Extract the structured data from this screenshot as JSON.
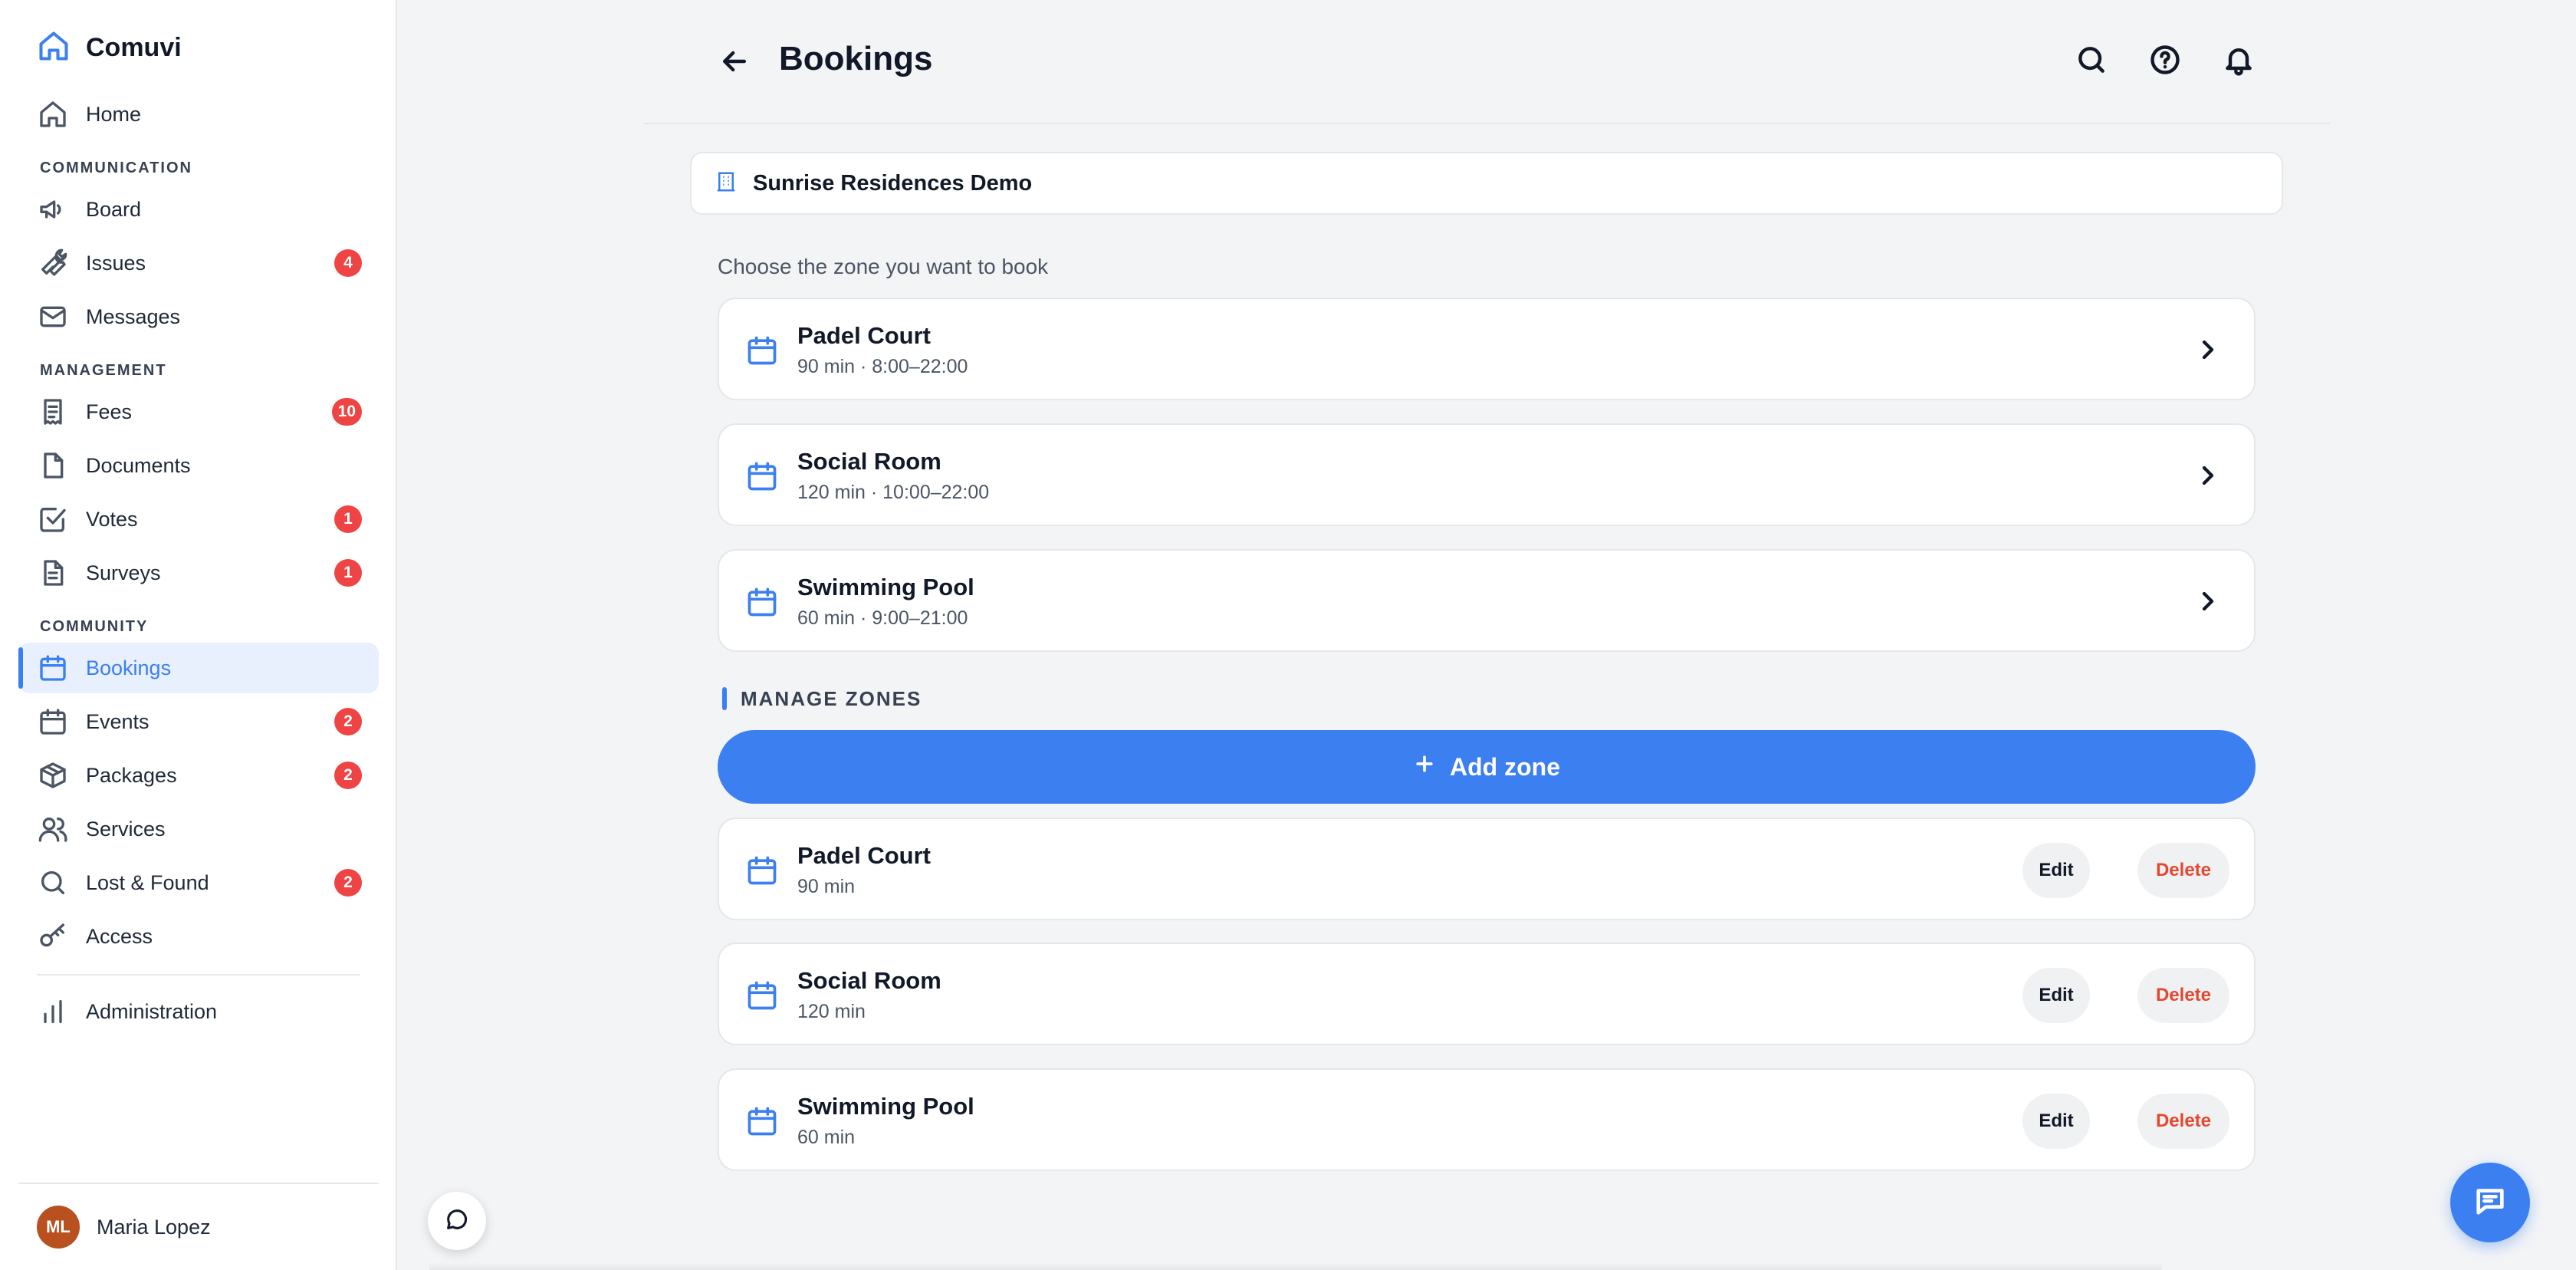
{
  "app": {
    "name": "Comuvi"
  },
  "sidebar": {
    "items": [
      {
        "label": "Home",
        "icon": "home-icon"
      },
      {
        "label": "Board",
        "icon": "megaphone-icon"
      },
      {
        "label": "Issues",
        "icon": "wrench-icon",
        "badge": "4"
      },
      {
        "label": "Messages",
        "icon": "mail-icon"
      },
      {
        "label": "Fees",
        "icon": "receipt-icon",
        "badge": "10"
      },
      {
        "label": "Documents",
        "icon": "document-icon"
      },
      {
        "label": "Votes",
        "icon": "checkbox-icon",
        "badge": "1"
      },
      {
        "label": "Surveys",
        "icon": "survey-icon",
        "badge": "1"
      },
      {
        "label": "Bookings",
        "icon": "calendar-icon",
        "active": true
      },
      {
        "label": "Events",
        "icon": "calendar-icon",
        "badge": "2"
      },
      {
        "label": "Packages",
        "icon": "package-icon",
        "badge": "2"
      },
      {
        "label": "Services",
        "icon": "users-icon"
      },
      {
        "label": "Lost & Found",
        "icon": "search-icon",
        "badge": "2"
      },
      {
        "label": "Access",
        "icon": "key-icon"
      },
      {
        "label": "Administration",
        "icon": "bar-chart-icon"
      }
    ],
    "sections": {
      "communication": "COMMUNICATION",
      "management": "MANAGEMENT",
      "community": "COMMUNITY"
    },
    "user": {
      "initials": "ML",
      "name": "Maria Lopez"
    }
  },
  "header": {
    "title": "Bookings"
  },
  "main": {
    "community": "Sunrise Residences Demo",
    "choose_prompt": "Choose the zone you want to book",
    "zones": [
      {
        "name": "Padel Court",
        "meta": "90 min · 8:00–22:00"
      },
      {
        "name": "Social Room",
        "meta": "120 min · 10:00–22:00"
      },
      {
        "name": "Swimming Pool",
        "meta": "60 min · 9:00–21:00"
      }
    ],
    "manage_title": "MANAGE ZONES",
    "add_zone_label": "Add zone",
    "managed_zones": [
      {
        "name": "Padel Court",
        "duration": "90 min",
        "edit": "Edit",
        "delete": "Delete"
      },
      {
        "name": "Social Room",
        "duration": "120 min",
        "edit": "Edit",
        "delete": "Delete"
      },
      {
        "name": "Swimming Pool",
        "duration": "60 min",
        "edit": "Edit",
        "delete": "Delete"
      }
    ]
  },
  "colors": {
    "accent": "#3b7ff0",
    "badge": "#ef4444",
    "delete": "#e5482f",
    "avatar": "#b8501f"
  }
}
